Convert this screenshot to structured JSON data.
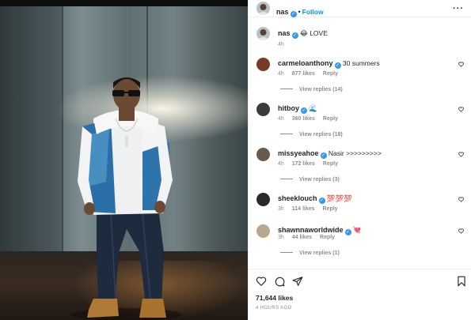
{
  "post": {
    "author": "nas",
    "follow_label": "Follow",
    "caption_emoji": "😂",
    "caption_text": "LOVE",
    "caption_time": "4h",
    "likes": "71,644 likes",
    "posted": "4 HOURS AGO"
  },
  "comments": [
    {
      "user": "carmeloanthony",
      "text": "30 summers",
      "time": "4h",
      "likes": "877 likes",
      "reply": "Reply",
      "replies": "View replies (14)",
      "avatar_color": "#7a3a2a"
    },
    {
      "user": "hitboy",
      "text": "🌊",
      "time": "4h",
      "likes": "360 likes",
      "reply": "Reply",
      "replies": "View replies (18)",
      "avatar_color": "#3b3b3b"
    },
    {
      "user": "missyeahoe",
      "text": "Nasir >>>>>>>>>",
      "time": "4h",
      "likes": "172 likes",
      "reply": "Reply",
      "replies": "View replies (3)",
      "avatar_color": "#6a5a4a"
    },
    {
      "user": "sheeklouch",
      "text": "💯💯💯",
      "time": "3h",
      "likes": "114 likes",
      "reply": "Reply",
      "replies": "",
      "avatar_color": "#2a2a2a"
    },
    {
      "user": "shawnnaworldwide",
      "text": "💘",
      "time": "3h",
      "likes": "44 likes",
      "reply": "Reply",
      "replies": "View replies (1)",
      "avatar_color": "#b8a890"
    }
  ],
  "icons": [
    "more-icon",
    "verified-icon",
    "heart-icon",
    "comment-icon",
    "share-icon",
    "bookmark-icon"
  ],
  "colors": {
    "accent": "#0095f6",
    "verified": "#3897f0",
    "muted": "#8e8e8e",
    "text": "#262626"
  }
}
